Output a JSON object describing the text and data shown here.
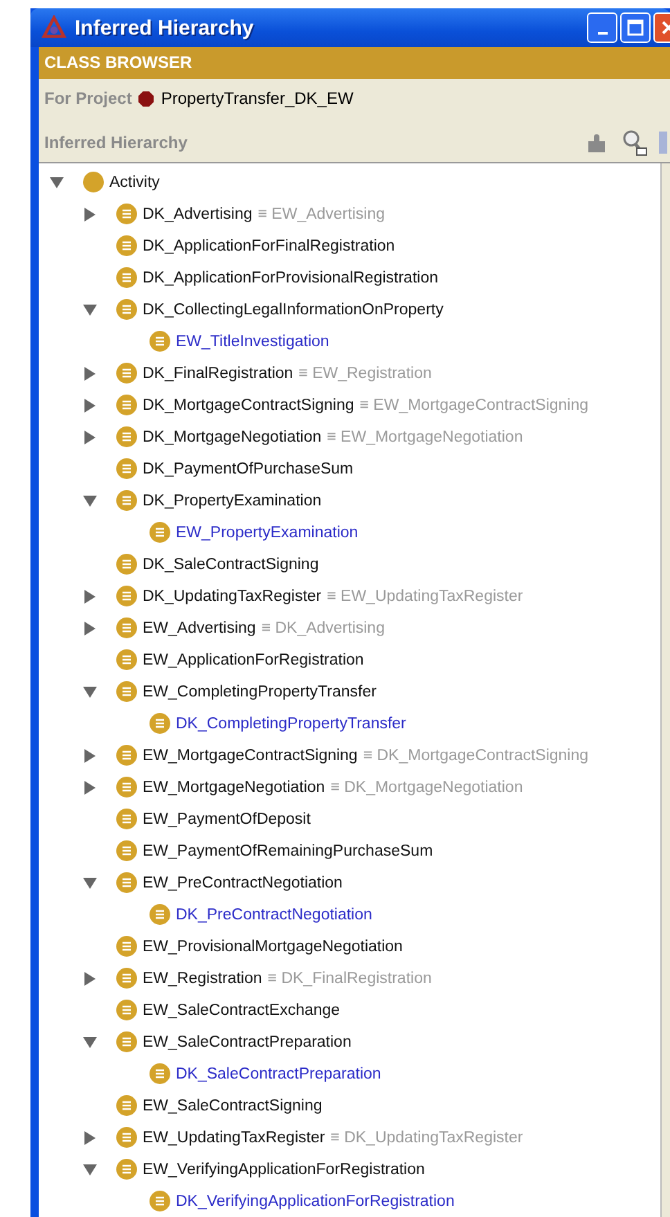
{
  "window": {
    "title": "Inferred Hierarchy"
  },
  "class_browser": {
    "title": "CLASS BROWSER",
    "project_label": "For Project",
    "project_name": "PropertyTransfer_DK_EW"
  },
  "hierarchy": {
    "title": "Inferred Hierarchy",
    "tree": [
      {
        "label": "Activity",
        "defined": false,
        "inferred": false,
        "kind": "branch",
        "expanded": true,
        "children": [
          {
            "label": "DK_Advertising",
            "equivalent": "≡ EW_Advertising",
            "defined": true,
            "inferred": false,
            "kind": "branch",
            "expanded": false
          },
          {
            "label": "DK_ApplicationForFinalRegistration",
            "defined": true,
            "inferred": false,
            "kind": "leaf"
          },
          {
            "label": "DK_ApplicationForProvisionalRegistration",
            "defined": true,
            "inferred": false,
            "kind": "leaf"
          },
          {
            "label": "DK_CollectingLegalInformationOnProperty",
            "defined": true,
            "inferred": false,
            "kind": "branch",
            "expanded": true,
            "children": [
              {
                "label": "EW_TitleInvestigation",
                "defined": true,
                "inferred": true,
                "kind": "leaf"
              }
            ]
          },
          {
            "label": "DK_FinalRegistration",
            "equivalent": "≡ EW_Registration",
            "defined": true,
            "inferred": false,
            "kind": "branch",
            "expanded": false
          },
          {
            "label": "DK_MortgageContractSigning",
            "equivalent": "≡ EW_MortgageContractSigning",
            "defined": true,
            "inferred": false,
            "kind": "branch",
            "expanded": false
          },
          {
            "label": "DK_MortgageNegotiation",
            "equivalent": "≡ EW_MortgageNegotiation",
            "defined": true,
            "inferred": false,
            "kind": "branch",
            "expanded": false
          },
          {
            "label": "DK_PaymentOfPurchaseSum",
            "defined": true,
            "inferred": false,
            "kind": "leaf"
          },
          {
            "label": "DK_PropertyExamination",
            "defined": true,
            "inferred": false,
            "kind": "branch",
            "expanded": true,
            "children": [
              {
                "label": "EW_PropertyExamination",
                "defined": true,
                "inferred": true,
                "kind": "leaf"
              }
            ]
          },
          {
            "label": "DK_SaleContractSigning",
            "defined": true,
            "inferred": false,
            "kind": "leaf"
          },
          {
            "label": "DK_UpdatingTaxRegister",
            "equivalent": "≡ EW_UpdatingTaxRegister",
            "defined": true,
            "inferred": false,
            "kind": "branch",
            "expanded": false
          },
          {
            "label": "EW_Advertising",
            "equivalent": "≡ DK_Advertising",
            "defined": true,
            "inferred": false,
            "kind": "branch",
            "expanded": false
          },
          {
            "label": "EW_ApplicationForRegistration",
            "defined": true,
            "inferred": false,
            "kind": "leaf"
          },
          {
            "label": "EW_CompletingPropertyTransfer",
            "defined": true,
            "inferred": false,
            "kind": "branch",
            "expanded": true,
            "children": [
              {
                "label": "DK_CompletingPropertyTransfer",
                "defined": true,
                "inferred": true,
                "kind": "leaf"
              }
            ]
          },
          {
            "label": "EW_MortgageContractSigning",
            "equivalent": "≡ DK_MortgageContractSigning",
            "defined": true,
            "inferred": false,
            "kind": "branch",
            "expanded": false
          },
          {
            "label": "EW_MortgageNegotiation",
            "equivalent": "≡ DK_MortgageNegotiation",
            "defined": true,
            "inferred": false,
            "kind": "branch",
            "expanded": false
          },
          {
            "label": "EW_PaymentOfDeposit",
            "defined": true,
            "inferred": false,
            "kind": "leaf"
          },
          {
            "label": "EW_PaymentOfRemainingPurchaseSum",
            "defined": true,
            "inferred": false,
            "kind": "leaf"
          },
          {
            "label": "EW_PreContractNegotiation",
            "defined": true,
            "inferred": false,
            "kind": "branch",
            "expanded": true,
            "children": [
              {
                "label": "DK_PreContractNegotiation",
                "defined": true,
                "inferred": true,
                "kind": "leaf"
              }
            ]
          },
          {
            "label": "EW_ProvisionalMortgageNegotiation",
            "defined": true,
            "inferred": false,
            "kind": "leaf"
          },
          {
            "label": "EW_Registration",
            "equivalent": "≡ DK_FinalRegistration",
            "defined": true,
            "inferred": false,
            "kind": "branch",
            "expanded": false
          },
          {
            "label": "EW_SaleContractExchange",
            "defined": true,
            "inferred": false,
            "kind": "leaf"
          },
          {
            "label": "EW_SaleContractPreparation",
            "defined": true,
            "inferred": false,
            "kind": "branch",
            "expanded": true,
            "children": [
              {
                "label": "DK_SaleContractPreparation",
                "defined": true,
                "inferred": true,
                "kind": "leaf"
              }
            ]
          },
          {
            "label": "EW_SaleContractSigning",
            "defined": true,
            "inferred": false,
            "kind": "leaf"
          },
          {
            "label": "EW_UpdatingTaxRegister",
            "equivalent": "≡ DK_UpdatingTaxRegister",
            "defined": true,
            "inferred": false,
            "kind": "branch",
            "expanded": false
          },
          {
            "label": "EW_VerifyingApplicationForRegistration",
            "defined": true,
            "inferred": false,
            "kind": "branch",
            "expanded": true,
            "children": [
              {
                "label": "DK_VerifyingApplicationForRegistration",
                "defined": true,
                "inferred": true,
                "kind": "leaf"
              }
            ]
          }
        ]
      }
    ]
  }
}
